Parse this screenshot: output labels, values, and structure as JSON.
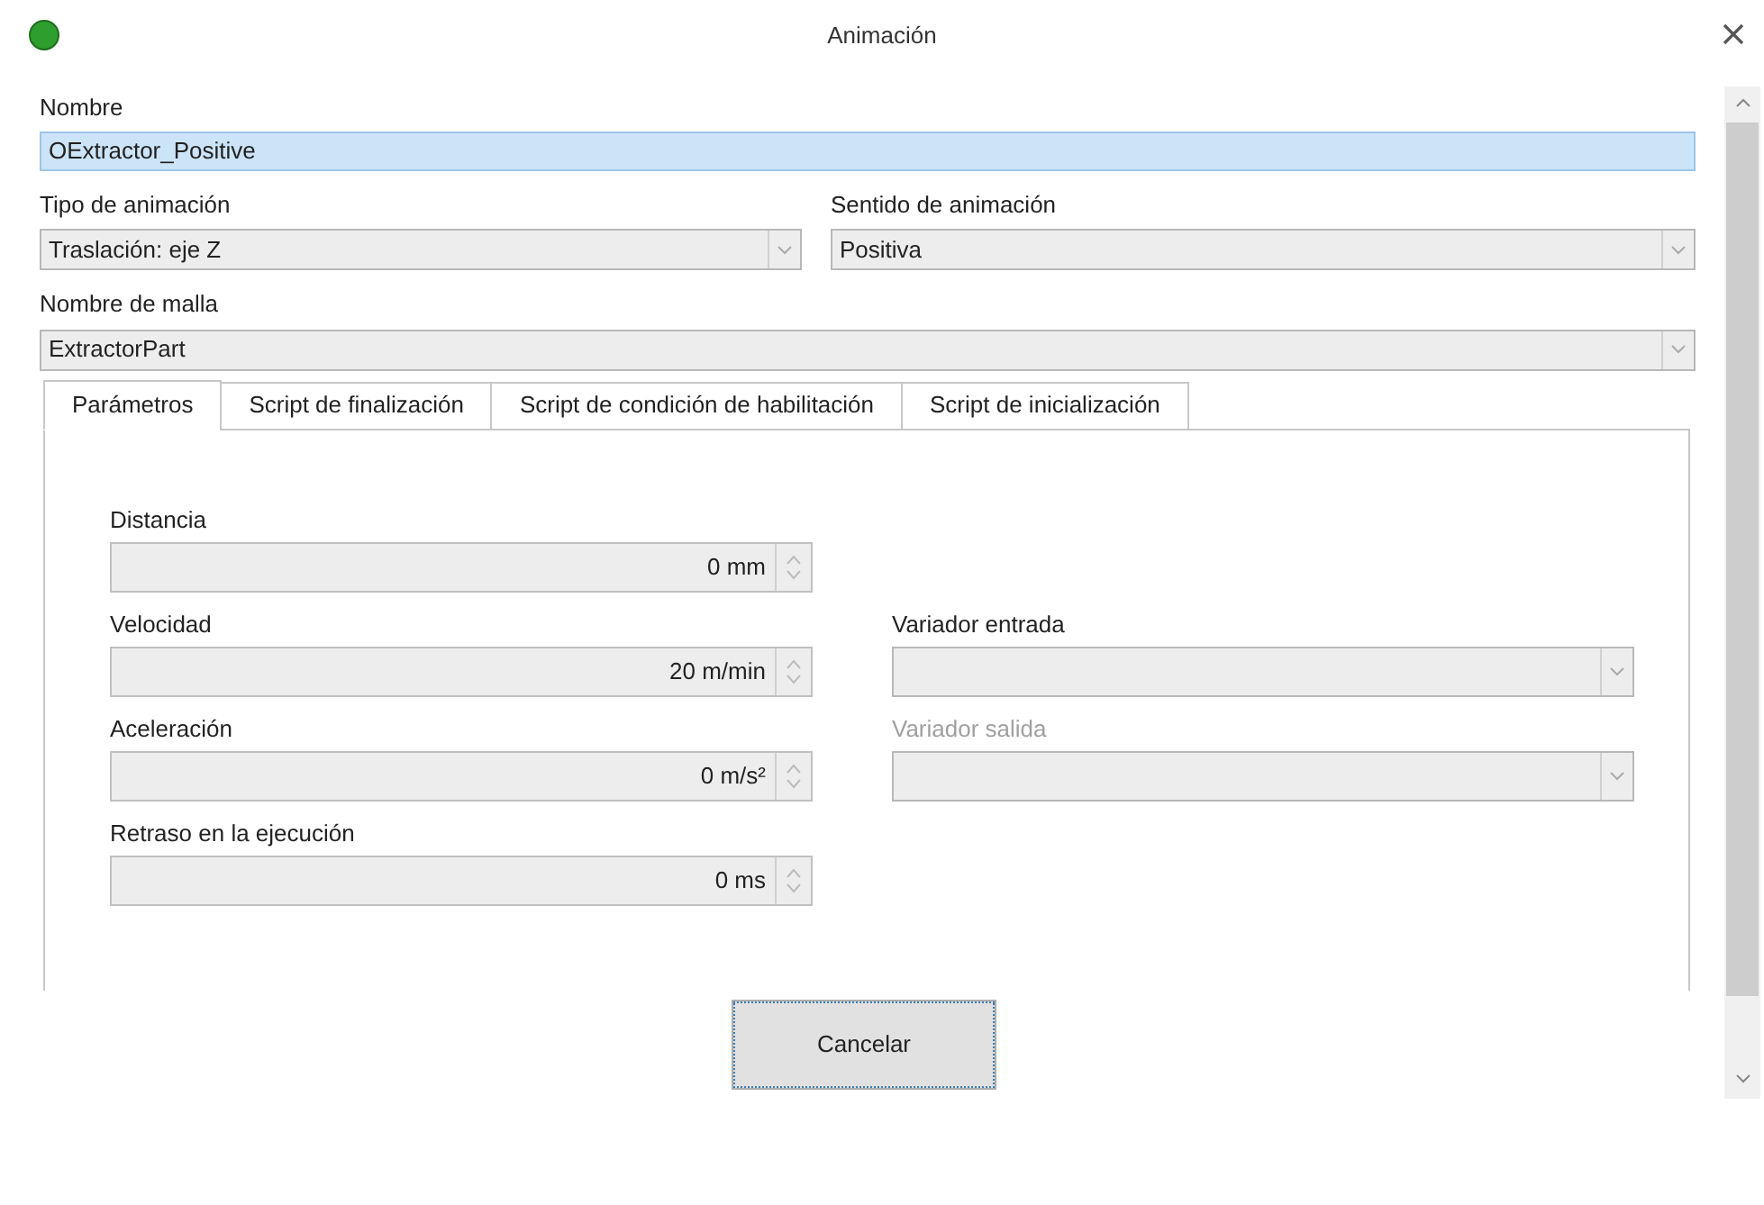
{
  "window": {
    "title": "Animación"
  },
  "name_field": {
    "label": "Nombre",
    "value": "OExtractor_Positive"
  },
  "combos": [
    {
      "label": "Tipo de animación",
      "value": "Traslación: eje Z"
    },
    {
      "label": "Sentido de animación",
      "value": "Positiva"
    }
  ],
  "mesh": {
    "label": "Nombre de malla",
    "value": "ExtractorPart"
  },
  "tabs": [
    {
      "label": "Parámetros",
      "selected": true
    },
    {
      "label": "Script de finalización",
      "selected": false
    },
    {
      "label": "Script de condición de habilitación",
      "selected": false
    },
    {
      "label": "Script de inicialización",
      "selected": false
    }
  ],
  "parameters": [
    {
      "left": {
        "label": "Distancia",
        "value": "0 mm"
      }
    },
    {
      "left": {
        "label": "Velocidad",
        "value": "20 m/min"
      },
      "right": {
        "label": "Variador entrada",
        "disabled": false
      }
    },
    {
      "left": {
        "label": "Aceleración",
        "value": "0 m/s²"
      },
      "right": {
        "label": "Variador salida",
        "disabled": true
      }
    },
    {
      "left": {
        "label": "Retraso en la ejecución",
        "value": "0 ms"
      }
    }
  ],
  "buttons": [
    {
      "label": "Cancelar"
    }
  ]
}
